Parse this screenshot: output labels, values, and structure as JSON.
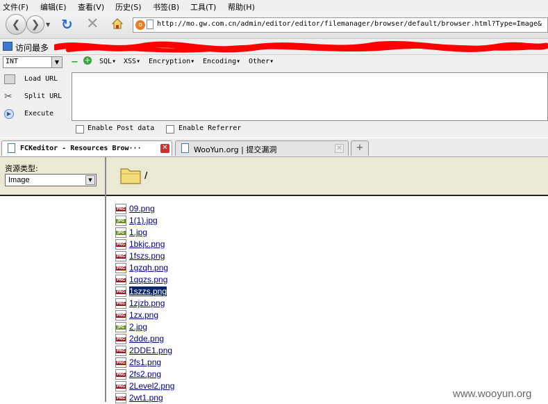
{
  "menu": [
    "文件(F)",
    "编辑(E)",
    "查看(V)",
    "历史(S)",
    "书签(B)",
    "工具(T)",
    "帮助(H)"
  ],
  "address": {
    "url": "http://mo.gw.com.cn/admin/editor/editor/filemanager/browser/default/browser.html?Type=Image&"
  },
  "bookmarks": {
    "most_visited": "访问最多"
  },
  "hackbar": {
    "select_value": "INT",
    "menus": [
      "SQL",
      "XSS",
      "Encryption",
      "Encoding",
      "Other"
    ],
    "load_url": "Load URL",
    "split_url": "Split URL",
    "execute": "Execute",
    "enable_post": "Enable Post data",
    "enable_referrer": "Enable Referrer"
  },
  "tabs": [
    {
      "title": "FCKeditor - Resources Brow···",
      "active": true
    },
    {
      "title": "WooYun.org | 提交漏洞",
      "active": false
    }
  ],
  "new_tab": "+",
  "browser": {
    "resource_type_label": "资源类型:",
    "resource_type_value": "Image",
    "path": "/",
    "files": [
      {
        "name": "09.png",
        "type": "PNG"
      },
      {
        "name": "1(1).jpg",
        "type": "JPG"
      },
      {
        "name": "1.jpg",
        "type": "JPG"
      },
      {
        "name": "1bkjc.png",
        "type": "PNG"
      },
      {
        "name": "1fszs.png",
        "type": "PNG"
      },
      {
        "name": "1gzqh.png",
        "type": "PNG"
      },
      {
        "name": "1qqzs.png",
        "type": "PNG"
      },
      {
        "name": "1szzs.png",
        "type": "PNG",
        "selected": true
      },
      {
        "name": "1zjzb.png",
        "type": "PNG"
      },
      {
        "name": "1zx.png",
        "type": "PNG"
      },
      {
        "name": "2.jpg",
        "type": "JPG"
      },
      {
        "name": "2dde.png",
        "type": "PNG"
      },
      {
        "name": "2DDE1.png",
        "type": "PNG"
      },
      {
        "name": "2fs1.png",
        "type": "PNG"
      },
      {
        "name": "2fs2.png",
        "type": "PNG"
      },
      {
        "name": "2Level2.png",
        "type": "PNG"
      },
      {
        "name": "2wt1.png",
        "type": "PNG"
      }
    ]
  },
  "watermark": "www.wooyun.org",
  "colors": {
    "png_band": "#a0141e",
    "jpg_band": "#6b8e23",
    "link": "#000080",
    "selection": "#0a246a",
    "redaction": "#ff0000"
  }
}
